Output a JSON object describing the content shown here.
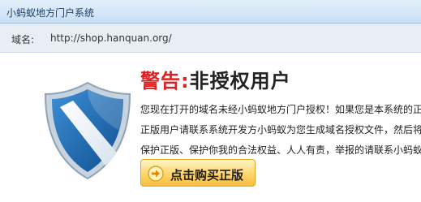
{
  "window": {
    "title": "小蚂蚁地方门户系统"
  },
  "address": {
    "label": "域名:",
    "url": "http://shop.hanquan.org/"
  },
  "warning": {
    "label": "警告:",
    "title": "非授权用户"
  },
  "message": {
    "lines": [
      "您现在打开的域名未经小蚂蚁地方门户授权！如果您是本系统的正",
      "正版用户请联系系统开发方小蚂蚁为您生成域名授权文件，然后将",
      "保护正版、保护你我的合法权益、人人有责，举报的请联系小蚂蚁"
    ]
  },
  "buy_button": {
    "label": "点击购买正版",
    "icon": "arrow-right-icon"
  },
  "icons": {
    "shield": "shield-icon"
  },
  "colors": {
    "warning_red": "#e02020",
    "shield_blue": "#1f6fb4",
    "button_gold": "#ffd66b",
    "titlebar": "#c9def3"
  }
}
